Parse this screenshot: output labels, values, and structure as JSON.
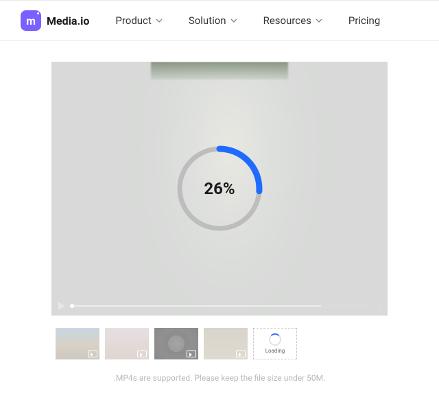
{
  "brand": {
    "name": "Media.io",
    "badge_letter": "m"
  },
  "nav": {
    "items": [
      {
        "label": "Product",
        "has_dropdown": true
      },
      {
        "label": "Solution",
        "has_dropdown": true
      },
      {
        "label": "Resources",
        "has_dropdown": true
      },
      {
        "label": "Pricing",
        "has_dropdown": false
      }
    ]
  },
  "player": {
    "progress_percent": 26,
    "progress_text": "26%",
    "time_display": "00:00/00:20"
  },
  "thumbnails": {
    "loading_tile_label": "Loading"
  },
  "hint_text": ".MP4s are supported. Please keep the file size under 50M.",
  "colors": {
    "brand": "#7B5FFF",
    "progress_arc": "#1F6BFF",
    "ring_bg": "#BDBDBD"
  }
}
